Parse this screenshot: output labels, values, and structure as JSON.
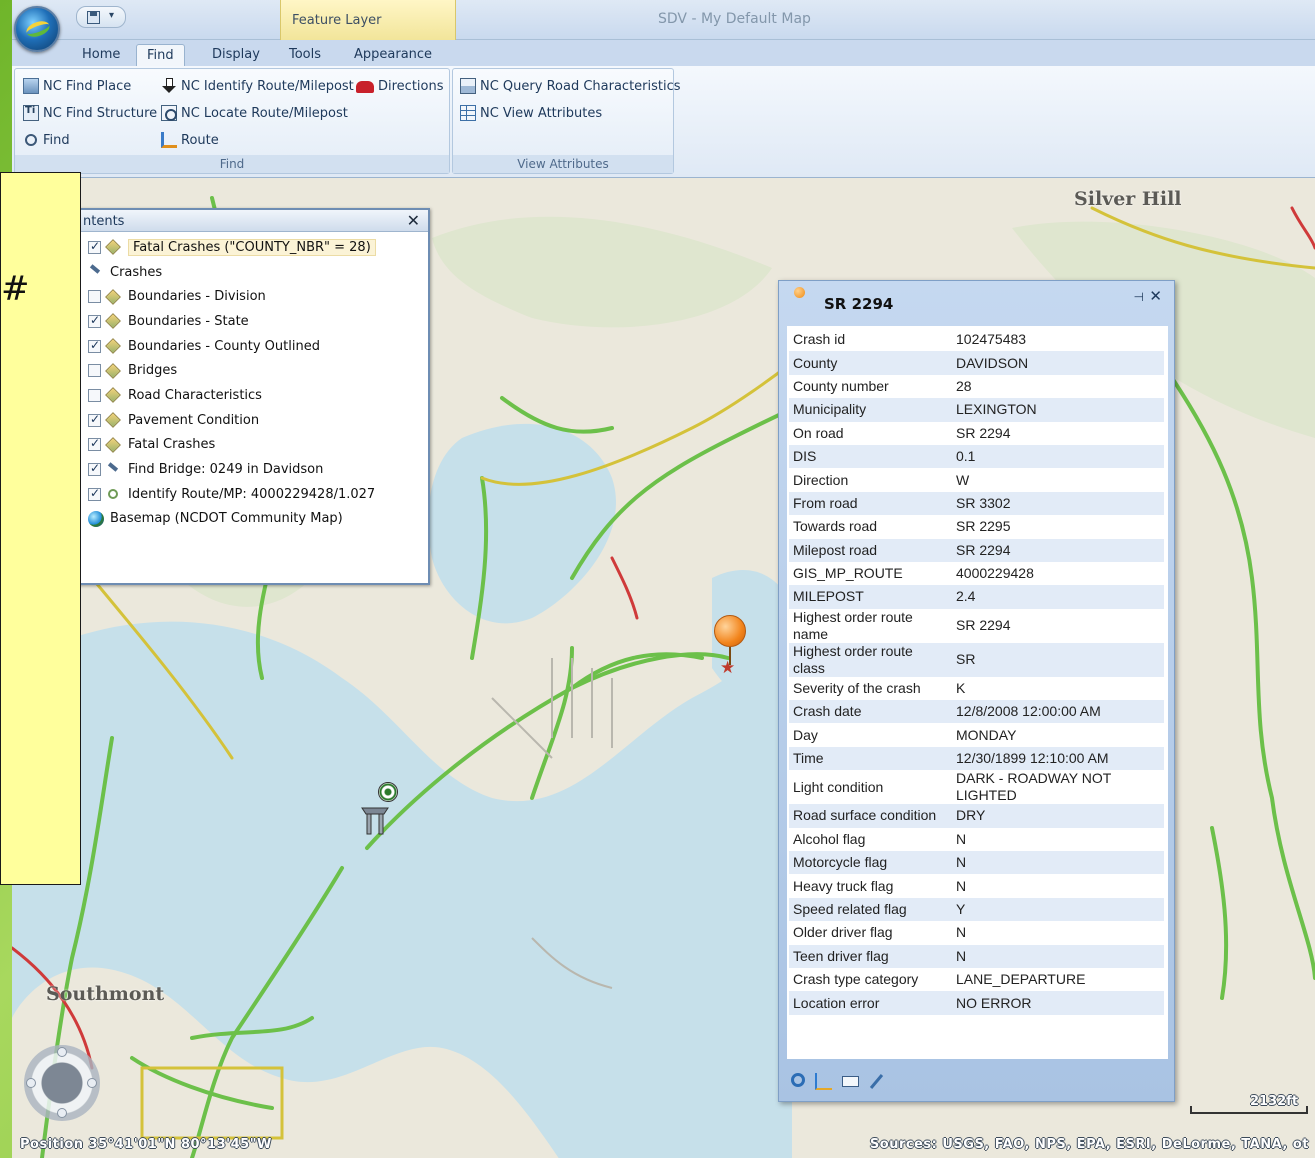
{
  "window": {
    "title": "SDV - My Default Map",
    "context_tab": "Feature Layer"
  },
  "ribbon": {
    "tabs": [
      "Home",
      "Find",
      "Display",
      "Tools",
      "Appearance"
    ],
    "active_tab": "Find",
    "find_group": {
      "label": "Find",
      "items": {
        "find_place": "NC Find Place",
        "find_structure": "NC Find Structure",
        "find": "Find",
        "identify_route": "NC Identify Route/Milepost",
        "locate_route": "NC Locate Route/Milepost",
        "route": "Route",
        "directions": "Directions"
      }
    },
    "view_attributes_group": {
      "label": "View Attributes",
      "items": {
        "query_road": "NC Query Road Characteristics",
        "view_attributes": "NC View Attributes"
      }
    }
  },
  "callout": {
    "text": "#"
  },
  "toc": {
    "title": "ntents",
    "layers": [
      {
        "label": "Fatal Crashes (\"COUNTY_NBR\" = 28)",
        "checked": true,
        "icon": "layer-icon",
        "highlighted": true
      },
      {
        "label": "Crashes",
        "checked": null,
        "icon": "tool-icon"
      },
      {
        "label": "Boundaries - Division",
        "checked": false,
        "icon": "layer-icon"
      },
      {
        "label": "Boundaries - State",
        "checked": true,
        "icon": "layer-icon"
      },
      {
        "label": "Boundaries - County Outlined",
        "checked": true,
        "icon": "layer-icon"
      },
      {
        "label": "Bridges",
        "checked": false,
        "icon": "layer-icon"
      },
      {
        "label": "Road Characteristics",
        "checked": false,
        "icon": "layer-icon"
      },
      {
        "label": "Pavement Condition",
        "checked": true,
        "icon": "layer-icon"
      },
      {
        "label": "Fatal Crashes",
        "checked": true,
        "icon": "layer-icon"
      },
      {
        "label": "Find Bridge: 0249 in Davidson",
        "checked": true,
        "icon": "bridge-icon"
      },
      {
        "label": "Identify Route/MP: 4000229428/1.027",
        "checked": true,
        "icon": "point-icon"
      },
      {
        "label": "Basemap (NCDOT Community Map)",
        "checked": null,
        "icon": "globe-icon"
      }
    ]
  },
  "popup": {
    "title": "SR 2294",
    "attributes": [
      [
        "Crash id",
        "102475483"
      ],
      [
        "County",
        "DAVIDSON"
      ],
      [
        "County number",
        "28"
      ],
      [
        "Municipality",
        "LEXINGTON"
      ],
      [
        "On road",
        "SR 2294"
      ],
      [
        "DIS",
        "0.1"
      ],
      [
        "Direction",
        "W"
      ],
      [
        "From road",
        "SR 3302"
      ],
      [
        "Towards road",
        "SR 2295"
      ],
      [
        "Milepost road",
        "SR 2294"
      ],
      [
        "GIS_MP_ROUTE",
        "4000229428"
      ],
      [
        "MILEPOST",
        "2.4"
      ],
      [
        "Highest order route name",
        "SR 2294"
      ],
      [
        "Highest order route class",
        "SR"
      ],
      [
        "Severity of the crash",
        "K"
      ],
      [
        "Crash date",
        "12/8/2008 12:00:00 AM"
      ],
      [
        "Day",
        "MONDAY"
      ],
      [
        "Time",
        "12/30/1899 12:10:00 AM"
      ],
      [
        "Light condition",
        "DARK - ROADWAY NOT LIGHTED"
      ],
      [
        "Road surface condition",
        "DRY"
      ],
      [
        "Alcohol flag",
        "N"
      ],
      [
        "Motorcycle flag",
        "N"
      ],
      [
        "Heavy truck flag",
        "N"
      ],
      [
        "Speed related flag",
        "Y"
      ],
      [
        "Older driver flag",
        "N"
      ],
      [
        "Teen driver flag",
        "N"
      ],
      [
        "Crash type category",
        "LANE_DEPARTURE"
      ],
      [
        "Location error",
        "NO ERROR"
      ]
    ]
  },
  "map": {
    "labels": {
      "silver_hill": "Silver Hill",
      "southmont": "Southmont"
    },
    "position": "Position 35°41'01\"N  80°13'45\"W",
    "sources": "Sources: USGS, FAO, NPS, EPA, ESRI, DeLorme, TANA, ot",
    "scale": "2132ft"
  }
}
